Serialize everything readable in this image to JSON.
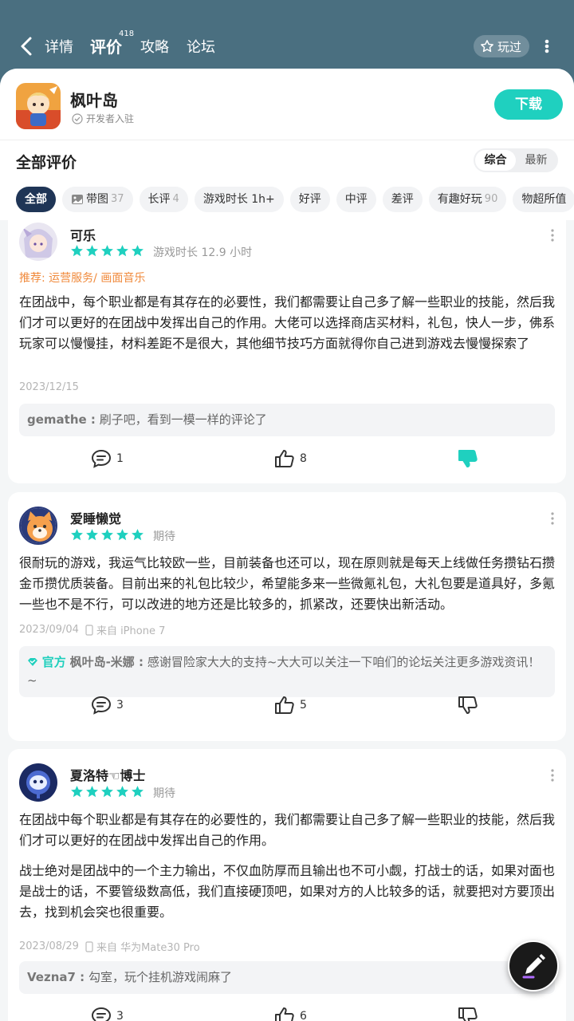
{
  "header": {
    "tabs": [
      {
        "label": "详情"
      },
      {
        "label": "评价",
        "badge": "418"
      },
      {
        "label": "攻略"
      },
      {
        "label": "论坛"
      }
    ],
    "played_label": "玩过"
  },
  "game": {
    "name": "枫叶岛",
    "dev_tag": "开发者入驻",
    "download_label": "下载"
  },
  "reviews_section": {
    "title": "全部评价",
    "sort": [
      "综合",
      "最新"
    ],
    "filters": [
      {
        "label": "全部",
        "count": ""
      },
      {
        "label": "带图",
        "count": "37"
      },
      {
        "label": "长评",
        "count": "4"
      },
      {
        "label": "游戏时长 1h+",
        "count": ""
      },
      {
        "label": "好评",
        "count": ""
      },
      {
        "label": "中评",
        "count": ""
      },
      {
        "label": "差评",
        "count": ""
      },
      {
        "label": "有趣好玩",
        "count": "90"
      },
      {
        "label": "物超所值",
        "count": ""
      }
    ]
  },
  "reviews": [
    {
      "name": "可乐",
      "rating": 5,
      "meta": "游戏时长 12.9 小时",
      "recommend": "推荐: 运营服务/ 画面音乐",
      "text": "在团战中，每个职业都是有其存在的必要性，我们都需要让自己多了解一些职业的技能，然后我们才可以更好的在团战中发挥出自己的作用。大佬可以选择商店买材料，礼包，快人一步，佛系玩家可以慢慢挂，材料差距不是很大，其他细节技巧方面就得你自己进到游戏去慢慢探索了",
      "date": "2023/12/15",
      "reply_user": "gemathe :",
      "reply_text": "刷子吧，看到一模一样的评论了",
      "comments": "1",
      "likes": "8"
    },
    {
      "name": "爱睡懒觉",
      "rating": 5,
      "meta": "期待",
      "text": "很耐玩的游戏，我运气比较欧一些，目前装备也还可以，现在原则就是每天上线做任务攒钻石攒金币攒优质装备。目前出来的礼包比较少，希望能多来一些微氪礼包，大礼包要是道具好，多氪一些也不是不行，可以改进的地方还是比较多的，抓紧改，还要快出新活动。",
      "date": "2023/09/04",
      "device": "来自 iPhone 7",
      "reply_official": "官方",
      "reply_user": "枫叶岛-米娜 :",
      "reply_text": "感谢冒险家大大的支持~大大可以关注一下咱们的论坛关注更多游戏资讯！~",
      "comments": "3",
      "likes": "5"
    },
    {
      "name": "夏洛特☜博士",
      "rating": 5,
      "meta": "期待",
      "text": "在团战中每个职业都是有其存在的必要性的，我们都需要让自己多了解一些职业的技能，然后我们才可以更好的在团战中发挥出自己的作用。",
      "text2": "战士绝对是团战中的一个主力输出，不仅血防厚而且输出也不可小觑，打战士的话，如果对面也是战士的话，不要管级数高低，我们直接硬顶吧，如果对方的人比较多的话，就要把对方要顶出去，找到机会突也很重要。",
      "date": "2023/08/29",
      "device": "来自 华为Mate30 Pro",
      "reply_user": "Vezna7 :",
      "reply_text": "勾室，玩个挂机游戏闹麻了",
      "comments": "3",
      "likes": "6"
    }
  ],
  "colors": {
    "accent": "#1fd0bf",
    "header_bg": "#4a6f80",
    "chip_active": "#1f3556",
    "recommend": "#f08a3c"
  }
}
